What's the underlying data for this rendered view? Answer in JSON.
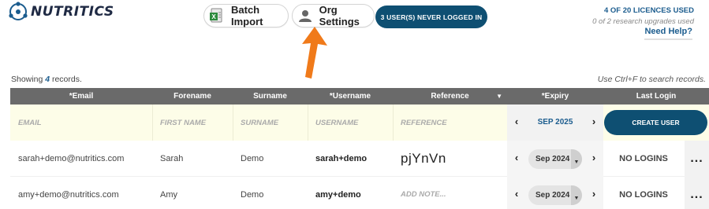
{
  "brand": {
    "name": "NUTRITICS"
  },
  "toolbar": {
    "batch_import": "Batch Import",
    "org_settings": "Org Settings",
    "never_logged_in": "3 USER(S) NEVER LOGGED IN"
  },
  "licences": {
    "used": "4 OF 20 LICENCES USED",
    "research": "0 of 2 research upgrades used",
    "help": "Need Help?"
  },
  "status": {
    "showing_prefix": "Showing",
    "count": "4",
    "showing_suffix": "records.",
    "search_hint": "Use Ctrl+F to search records."
  },
  "table": {
    "columns": [
      "*Email",
      "Forename",
      "Surname",
      "*Username",
      "Reference",
      "*Expiry",
      "Last Login"
    ],
    "sort_indicator": "▼",
    "new_row": {
      "email_placeholder": "EMAIL",
      "forename_placeholder": "FIRST NAME",
      "surname_placeholder": "SURNAME",
      "username_placeholder": "USERNAME",
      "reference_placeholder": "REFERENCE",
      "expiry": "SEP 2025",
      "create_button": "CREATE USER"
    },
    "rows": [
      {
        "email": "sarah+demo@nutritics.com",
        "forename": "Sarah",
        "surname": "Demo",
        "username": "sarah+demo",
        "reference": "pjYnVn",
        "expiry": "Sep 2024",
        "last_login": "NO LOGINS",
        "more": "..."
      },
      {
        "email": "amy+demo@nutritics.com",
        "forename": "Amy",
        "surname": "Demo",
        "username": "amy+demo",
        "reference": "ADD NOTE...",
        "expiry": "Sep 2024",
        "last_login": "NO LOGINS",
        "more": "..."
      }
    ]
  },
  "icons": {
    "prev": "‹",
    "next": "›",
    "dropdown": "▼"
  },
  "colors": {
    "brand_dark": "#0e4f72",
    "link": "#1b5c8e",
    "header_bg": "#6a6a6a",
    "new_row_bg": "#fdfde8",
    "arrow": "#f07a1a"
  }
}
